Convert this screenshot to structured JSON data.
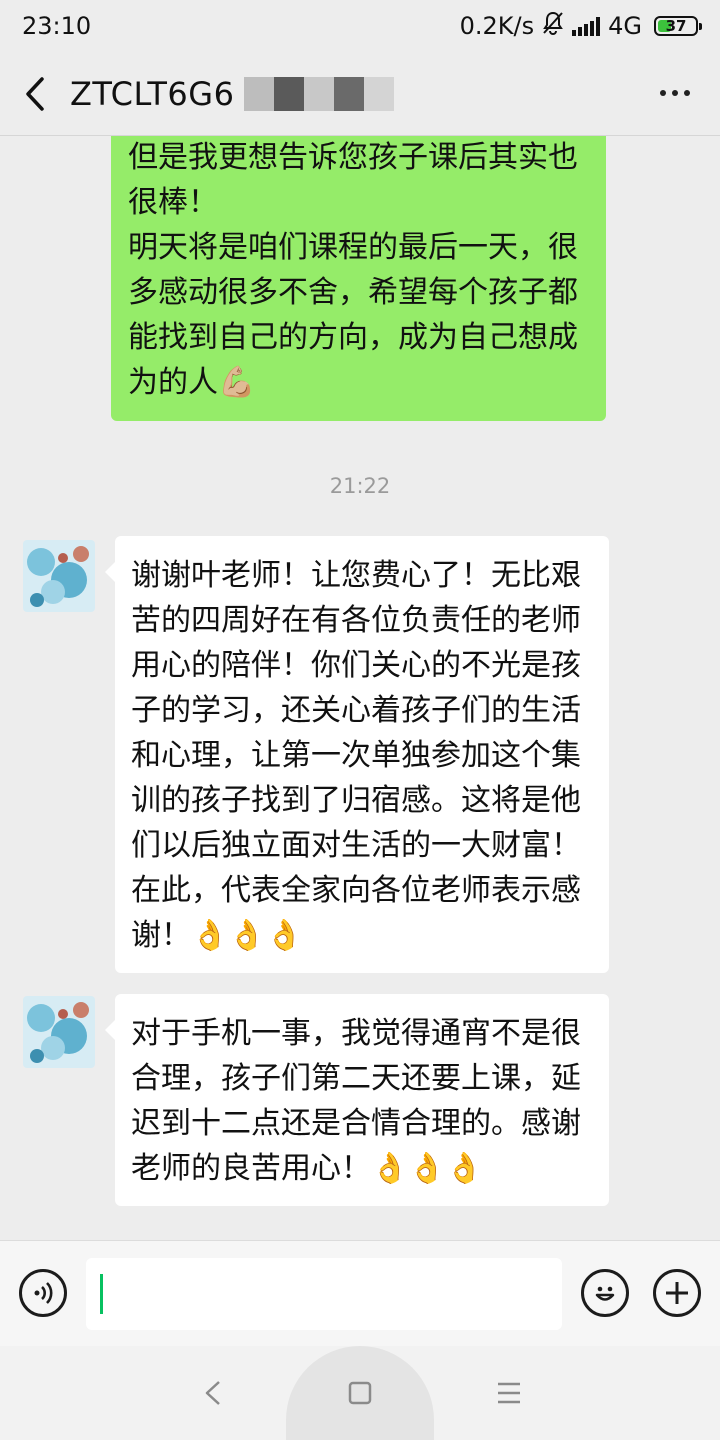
{
  "status_bar": {
    "time": "23:10",
    "net_speed": "0.2K/s",
    "network": "4G",
    "battery": "37",
    "battery_fraction": 0.37
  },
  "nav": {
    "title": "ZTCLT6G6",
    "back_icon": "chevron-left-icon",
    "more_icon": "more-dots-icon"
  },
  "messages": {
    "outgoing_1": {
      "text": "谈天能看到孩子们课堂上的情况，但是我更想告诉您孩子课后其实也很棒！\n明天将是咱们课程的最后一天，很多感动很多不舍，希望每个孩子都能找到自己的方向，成为自己想成为的人💪🏼"
    },
    "timestamp": "21:22",
    "incoming_1": {
      "text": "谢谢叶老师！让您费心了！无比艰苦的四周好在有各位负责任的老师用心的陪伴！你们关心的不光是孩子的学习，还关心着孩子们的生活和心理，让第一次单独参加这个集训的孩子找到了归宿感。这将是他们以后独立面对生活的一大财富！在此，代表全家向各位老师表示感谢！👌👌👌"
    },
    "incoming_2": {
      "text": "对于手机一事，我觉得通宵不是很合理，孩子们第二天还要上课，延迟到十二点还是合情合理的。感谢老师的良苦用心！👌👌👌"
    }
  },
  "input_bar": {
    "voice_icon": "voice-icon",
    "emoji_icon": "emoji-icon",
    "plus_icon": "plus-icon",
    "value": ""
  },
  "colors": {
    "outgoing_bubble": "#95ec69",
    "incoming_bubble": "#ffffff",
    "background": "#ededed",
    "caret": "#07c160"
  }
}
